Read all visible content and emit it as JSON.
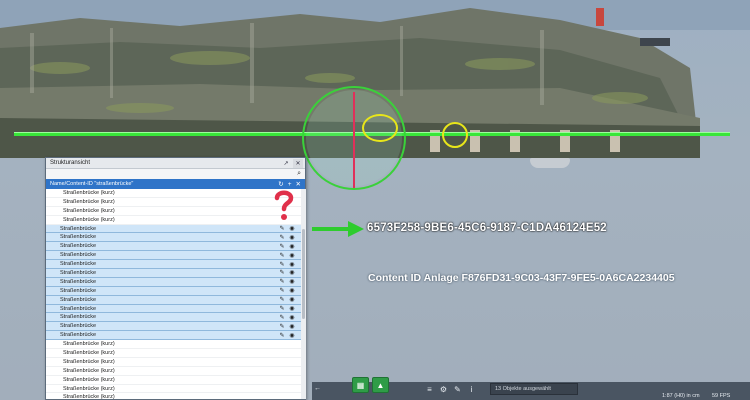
{
  "panel": {
    "title": "Strukturansicht",
    "filter_label": "Name/Content-ID \"straßenbrücke\"",
    "rows": [
      {
        "label": "Straßenbrücke (kurz)",
        "selected": false
      },
      {
        "label": "Straßenbrücke (kurz)",
        "selected": false
      },
      {
        "label": "Straßenbrücke (kurz)",
        "selected": false
      },
      {
        "label": "Straßenbrücke (kurz)",
        "selected": false
      },
      {
        "label": "Straßenbrücke",
        "selected": true
      },
      {
        "label": "Straßenbrücke",
        "selected": true
      },
      {
        "label": "Straßenbrücke",
        "selected": true
      },
      {
        "label": "Straßenbrücke",
        "selected": true
      },
      {
        "label": "Straßenbrücke",
        "selected": true
      },
      {
        "label": "Straßenbrücke",
        "selected": true
      },
      {
        "label": "Straßenbrücke",
        "selected": true
      },
      {
        "label": "Straßenbrücke",
        "selected": true
      },
      {
        "label": "Straßenbrücke",
        "selected": true
      },
      {
        "label": "Straßenbrücke",
        "selected": true
      },
      {
        "label": "Straßenbrücke",
        "selected": true
      },
      {
        "label": "Straßenbrücke",
        "selected": true
      },
      {
        "label": "Straßenbrücke",
        "selected": true
      },
      {
        "label": "Straßenbrücke (kurz)",
        "selected": false
      },
      {
        "label": "Straßenbrücke (kurz)",
        "selected": false
      },
      {
        "label": "Straßenbrücke (kurz)",
        "selected": false
      },
      {
        "label": "Straßenbrücke (kurz)",
        "selected": false
      },
      {
        "label": "Straßenbrücke (kurz)",
        "selected": false
      },
      {
        "label": "Straßenbrücke (kurz)",
        "selected": false
      },
      {
        "label": "Straßenbrücke (kurz)",
        "selected": false
      }
    ]
  },
  "annotations": {
    "content_id": "6573F258-9BE6-45C6-9187-C1DA46124E52",
    "anlage": "Content ID Anlage  F876FD31-9C03-43F7-9FE5-0A6CA2234405",
    "question_mark": "?"
  },
  "toolbar": {
    "selection_status": "13 Objekte ausgewählt",
    "scale": "1:87 (H0) in cm",
    "fps": "59 FPS"
  },
  "colors": {
    "accent": "#2f74c8",
    "selected_row": "#cfe5f8",
    "rail_highlight": "#39e639",
    "ring_highlight": "#e8e61a",
    "question_mark": "#e0304a",
    "green_button": "#2f9c47"
  },
  "icons": {
    "row_pin": "pin-icon",
    "row_eye": "eye-icon",
    "search": "search-icon"
  }
}
